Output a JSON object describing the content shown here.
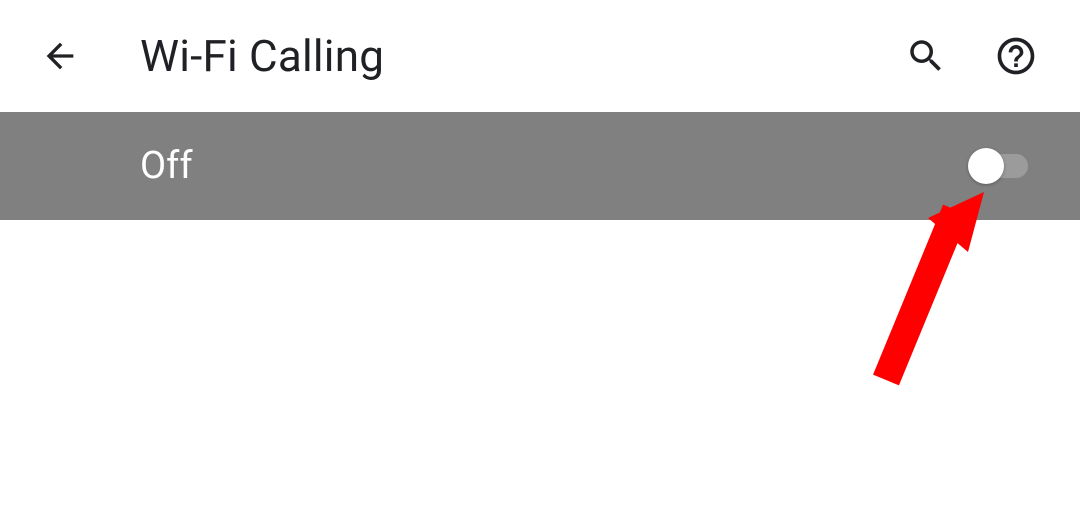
{
  "header": {
    "title": "Wi-Fi Calling"
  },
  "toggle": {
    "label": "Off",
    "state": false
  },
  "annotation": {
    "arrow_color": "#ff0000"
  }
}
